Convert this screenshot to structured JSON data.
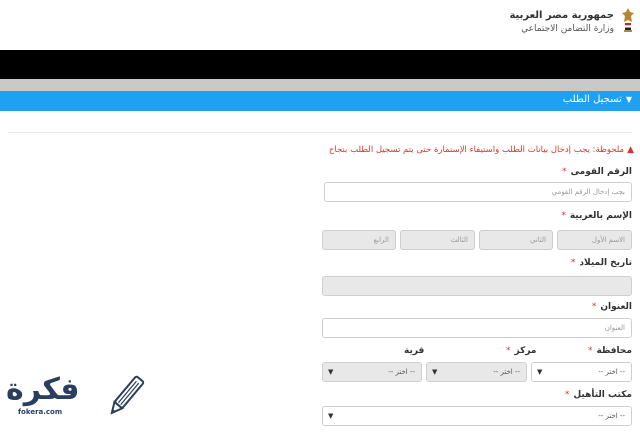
{
  "header": {
    "gov_name": "جمهورية مصر العربية",
    "ministry": "وزارة التضامن الاجتماعي",
    "emblem_icon": "egypt-eagle-emblem-icon"
  },
  "section": {
    "title": "تسجيل الطلب",
    "chevron_icon": "chevron-down-icon"
  },
  "note": {
    "icon": "warning-icon",
    "text": "ملحوظة: يجب إدخال بيانات الطلب واستيفاء الإستمارة حتى يتم تسجيل الطلب بنجاح"
  },
  "form": {
    "national_id": {
      "label": "الرقم القومى",
      "required": "*",
      "placeholder": "يجب إدخال الرقم القومي"
    },
    "arabic_name": {
      "label": "الإسم بالعربية",
      "required": "*",
      "first": "الاسم الأول",
      "second": "الثاني",
      "third": "الثالث",
      "fourth": "الرابع"
    },
    "birth_date": {
      "label": "تاريخ الميلاد",
      "required": "*",
      "value": ""
    },
    "address": {
      "label": "العنوان",
      "required": "*",
      "placeholder": "العنوان"
    },
    "governorate": {
      "label": "محافظة",
      "required": "*",
      "selected": "-- اختر --"
    },
    "center": {
      "label": "مركز",
      "required": "*",
      "selected": "-- اختر --"
    },
    "village": {
      "label": "قرية",
      "selected": "-- اختر --"
    },
    "rehab_office": {
      "label": "مكتب التأهيل",
      "required": "*",
      "selected": "-- اختر --"
    }
  },
  "watermark": {
    "text": "فكرة",
    "url": "fokera.com"
  },
  "colors": {
    "accent": "#1ea1f2",
    "required": "#d9362b",
    "header_bar": "#000000",
    "watermark": "#2a3e5f"
  }
}
